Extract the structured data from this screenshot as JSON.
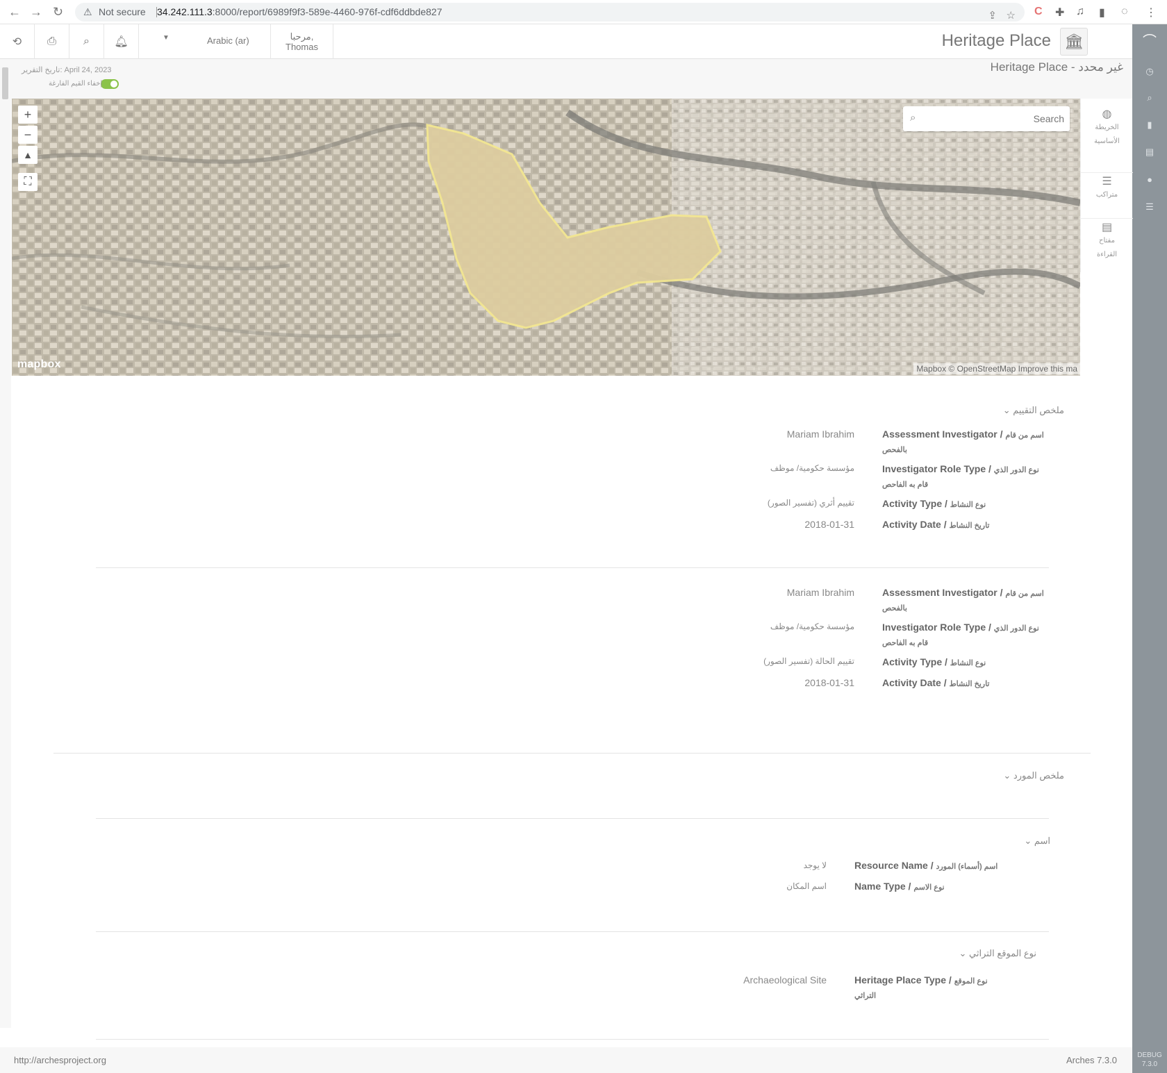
{
  "browser": {
    "security_label": "Not secure",
    "url_host": "34.242.111.3",
    "url_rest": ":8000/report/6989f9f3-589e-4460-976f-cdf6ddbde827"
  },
  "topnav": {
    "language": "Arabic (ar)",
    "greeting": "مرحبا,",
    "user": "Thomas",
    "brand_title": "Heritage Place"
  },
  "report": {
    "title": "Heritage Place - غير محدد",
    "date_label": "تاريخ التقرير: April 24, 2023",
    "hide_empty_label": "إخفاء القيم الفارغة"
  },
  "map": {
    "search_placeholder": "Search",
    "logo": "mapbox",
    "attribution": "Mapbox © OpenStreetMap Improve this ma",
    "side_items": [
      {
        "icon": "globe-icon",
        "line1": "الخريطة",
        "line2": "الأساسية"
      },
      {
        "icon": "list-icon",
        "line1": "متراكب",
        "line2": ""
      },
      {
        "icon": "legend-icon",
        "line1": "مفتاح",
        "line2": "القراءة"
      }
    ]
  },
  "assessment": {
    "header": "ملخص التقييم",
    "blocks": [
      {
        "investigator_label": "Assessment Investigator / ",
        "investigator_label_ar": "اسم من قام بالفحص",
        "investigator": "Mariam Ibrahim",
        "role_label": "Investigator Role Type / ",
        "role_label_ar": "نوع الدور الذي قام به الفاحص",
        "role": "مؤسسة حكومية/ موظف",
        "activity_label": "Activity Type / ",
        "activity_label_ar": "نوع النشاط",
        "activity": "تقييم أثري (تفسير الصور)",
        "date_label": "Activity Date / ",
        "date_label_ar": "تاريخ النشاط",
        "date": "2018-01-31"
      },
      {
        "investigator_label": "Assessment Investigator / ",
        "investigator_label_ar": "اسم من قام بالفحص",
        "investigator": "Mariam Ibrahim",
        "role_label": "Investigator Role Type / ",
        "role_label_ar": "نوع الدور الذي قام به الفاحص",
        "role": "مؤسسة حكومية/ موظف",
        "activity_label": "Activity Type / ",
        "activity_label_ar": "نوع النشاط",
        "activity": "تقييم الحالة (تفسير الصور)",
        "date_label": "Activity Date / ",
        "date_label_ar": "تاريخ النشاط",
        "date": "2018-01-31"
      }
    ]
  },
  "resource_summary": {
    "header": "ملخص المورد",
    "name_header": "اسم",
    "resource_name_label": "Resource Name / ",
    "resource_name_label_ar": "اسم (أسماء) المورد",
    "resource_name": "لا يوجد",
    "name_type_label": "Name Type / ",
    "name_type_label_ar": "نوع الاسم",
    "name_type": "اسم المكان",
    "place_type_header": "نوع الموقع التراثي",
    "place_type_label": "Heritage Place Type / ",
    "place_type_label_ar": "نوع الموقع التراثي",
    "place_type": "Archaeological Site"
  },
  "footer": {
    "link": "http://archesproject.org",
    "version": "Arches 7.3.0",
    "debug": "DEBUG",
    "debug_version": "7.3.0"
  }
}
